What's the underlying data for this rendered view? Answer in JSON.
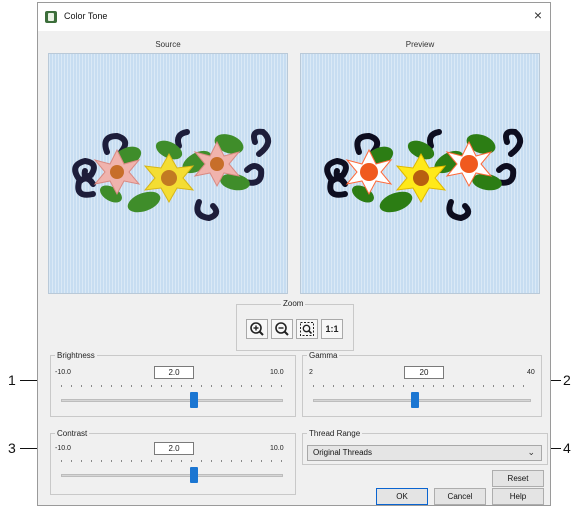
{
  "window": {
    "title": "Color Tone",
    "close_glyph": "×"
  },
  "panes": {
    "source_label": "Source",
    "preview_label": "Preview"
  },
  "zoom": {
    "label": "Zoom",
    "actual_size_label": "1:1"
  },
  "brightness": {
    "label": "Brightness",
    "min": "-10.0",
    "max": "10.0",
    "value": "2.0",
    "fraction": 0.6
  },
  "gamma": {
    "label": "Gamma",
    "min": "2",
    "max": "40",
    "value": "20",
    "fraction": 0.47
  },
  "contrast": {
    "label": "Contrast",
    "min": "-10.0",
    "max": "10.0",
    "value": "2.0",
    "fraction": 0.6
  },
  "thread_range": {
    "label": "Thread Range",
    "value": "Original Threads"
  },
  "buttons": {
    "reset": "Reset",
    "ok": "OK",
    "cancel": "Cancel",
    "help": "Help"
  },
  "callouts": {
    "c1": "1",
    "c2": "2",
    "c3": "3",
    "c4": "4"
  },
  "colors": {
    "accent": "#1b76d2",
    "pane_bg": "#c7ddf1"
  }
}
